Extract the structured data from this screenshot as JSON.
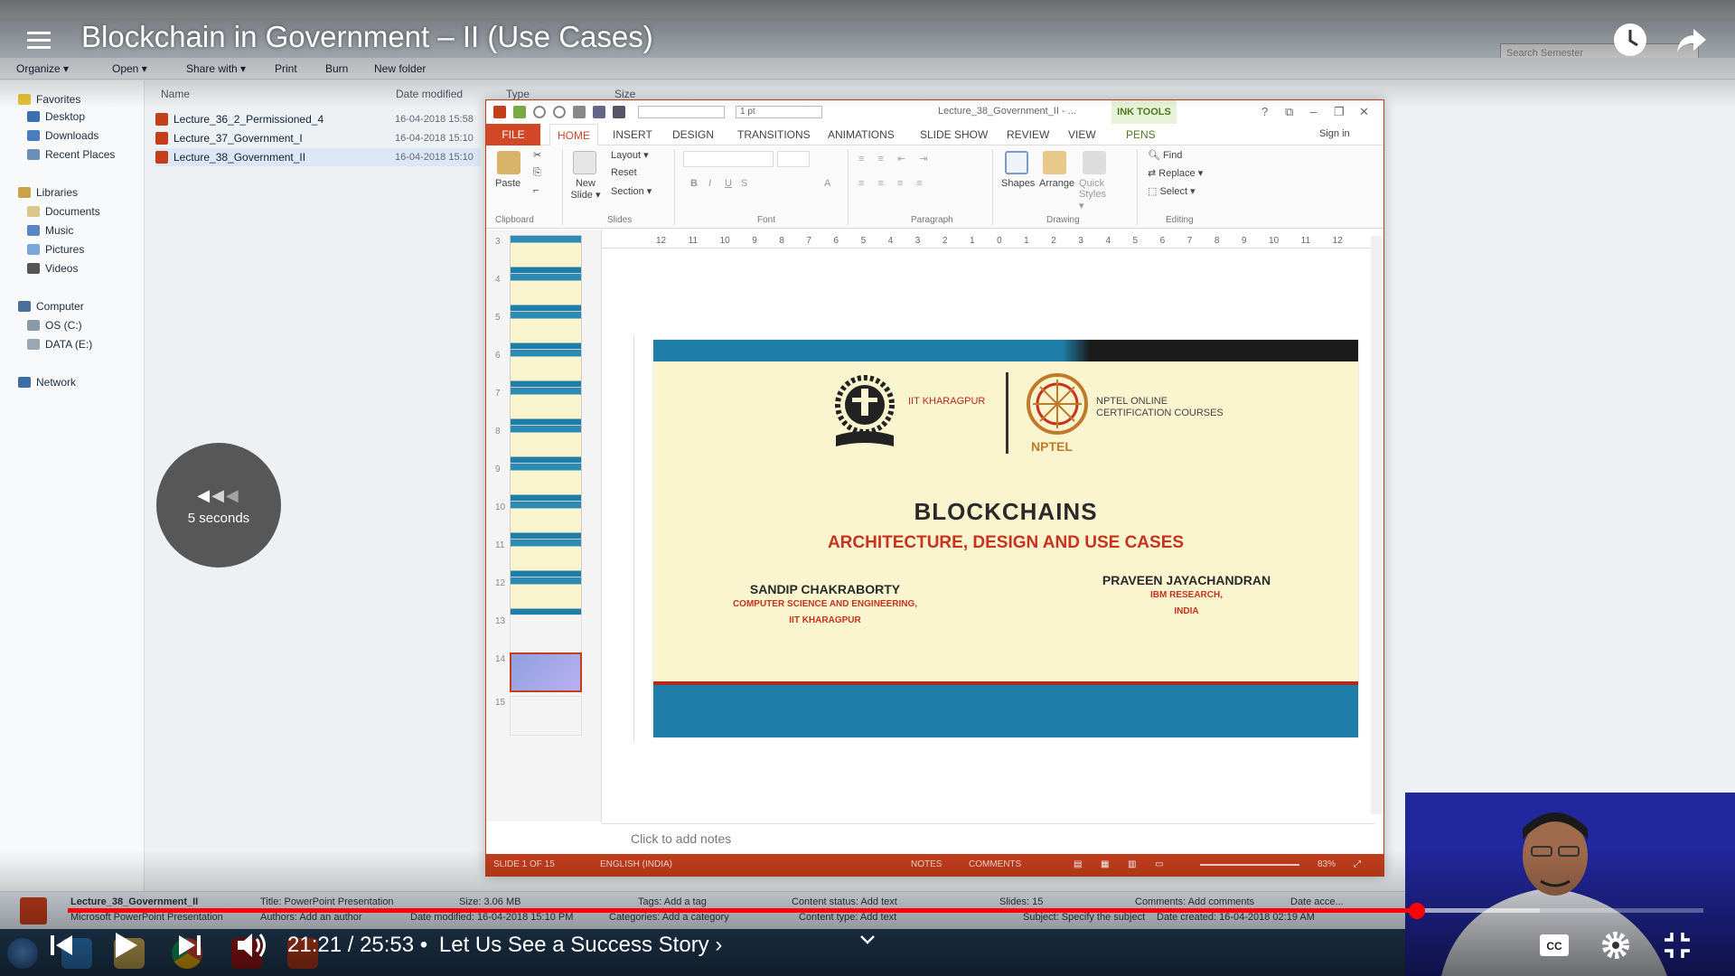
{
  "explorer": {
    "search_placeholder": "Search Semester",
    "commands": [
      "Organize ▾",
      "Open ▾",
      "Share with ▾",
      "Print",
      "Burn",
      "New folder"
    ],
    "nav": [
      "Favorites",
      "Desktop",
      "Downloads",
      "Recent Places",
      "Libraries",
      "Documents",
      "Music",
      "Pictures",
      "Videos",
      "Computer",
      "OS (C:)",
      "DATA (E:)",
      "Network"
    ],
    "columns": {
      "name": "Name",
      "date": "Date modified",
      "type": "Type",
      "size": "Size"
    },
    "files": [
      {
        "name": "Lecture_36_2_Permissioned_4",
        "date": "16-04-2018 15:58"
      },
      {
        "name": "Lecture_37_Government_I",
        "date": "16-04-2018 15:10"
      },
      {
        "name": "Lecture_38_Government_II",
        "date": "16-04-2018 15:10"
      }
    ],
    "details": {
      "file": "Lecture_38_Government_II",
      "kind": "Microsoft PowerPoint Presentation",
      "title": "Title: PowerPoint Presentation",
      "authors": "Authors: Add an author",
      "size": "Size: 3.06 MB",
      "modified": "Date modified: 16-04-2018 15:10 PM",
      "tags": "Tags: Add a tag",
      "categories": "Categories: Add a category",
      "content_status": "Content status: Add text",
      "content_type": "Content type: Add text",
      "slides": "Slides: 15",
      "subject": "Subject: Specify the subject",
      "comments": "Comments: Add comments",
      "created": "Date created: 16-04-2018 02:19 AM",
      "date_accessed": "Date acce..."
    }
  },
  "ppt": {
    "window_title": "Lecture_38_Government_II - ...",
    "ink_tools": "INK TOOLS",
    "tabs": [
      "FILE",
      "HOME",
      "INSERT",
      "DESIGN",
      "TRANSITIONS",
      "ANIMATIONS",
      "SLIDE SHOW",
      "REVIEW",
      "VIEW",
      "PENS"
    ],
    "sign_in": "Sign in",
    "ribbon": {
      "paste": "Paste",
      "new_slide": "New Slide ▾",
      "layout": "Layout ▾",
      "reset": "Reset",
      "section": "Section ▾",
      "shapes": "Shapes",
      "arrange": "Arrange",
      "quick_styles": "Quick Styles ▾",
      "find": "Find",
      "replace": "Replace ▾",
      "select": "Select ▾",
      "pen_width": "1 pt",
      "groups": [
        "Clipboard",
        "Slides",
        "Font",
        "Paragraph",
        "Drawing",
        "Editing"
      ]
    },
    "ruler": [
      "12",
      "11",
      "10",
      "9",
      "8",
      "7",
      "6",
      "5",
      "4",
      "3",
      "2",
      "1",
      "0",
      "1",
      "2",
      "3",
      "4",
      "5",
      "6",
      "7",
      "8",
      "9",
      "10",
      "11",
      "12"
    ],
    "thumb_numbers": [
      "3",
      "4",
      "5",
      "6",
      "7",
      "8",
      "9",
      "10",
      "11",
      "12",
      "13",
      "14",
      "15"
    ],
    "notes_placeholder": "Click to add notes",
    "status": {
      "slide": "SLIDE 1 OF 15",
      "language": "ENGLISH (INDIA)",
      "notes": "NOTES",
      "comments": "COMMENTS",
      "zoom": "83%"
    },
    "slide": {
      "org1": "IIT KHARAGPUR",
      "org2_line1": "NPTEL ONLINE",
      "org2_line2": "CERTIFICATION COURSES",
      "nptel": "NPTEL",
      "title": "BLOCKCHAINS",
      "subtitle": "ARCHITECTURE, DESIGN AND USE CASES",
      "author1": "SANDIP CHAKRABORTY",
      "author1_aff1": "COMPUTER SCIENCE AND ENGINEERING,",
      "author1_aff2": "IIT KHARAGPUR",
      "author2": "PRAVEEN JAYACHANDRAN",
      "author2_aff1": "IBM RESEARCH,",
      "author2_aff2": "INDIA"
    }
  },
  "youtube": {
    "title": "Blockchain in Government – II (Use Cases)",
    "time": "21:21 / 25:53",
    "separator": "•",
    "chapter": "Let Us See a Success Story ›",
    "seek_label": "5 seconds",
    "progress_fraction": 0.825,
    "loaded_fraction": 0.9,
    "accent": "#ff0000"
  }
}
